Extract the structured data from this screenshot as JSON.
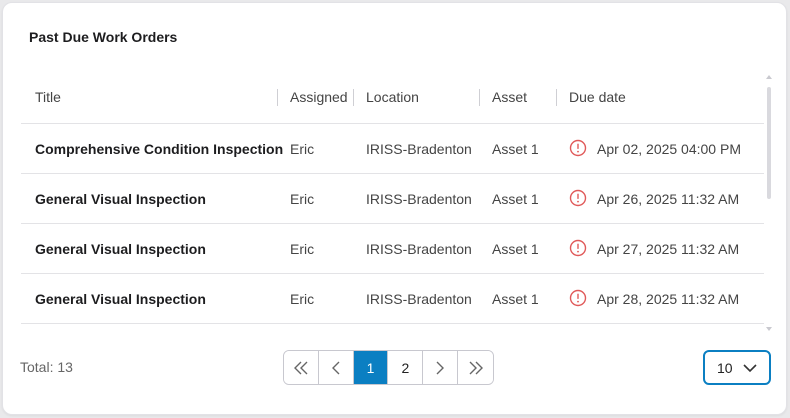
{
  "card": {
    "title": "Past Due Work Orders"
  },
  "table": {
    "columns": [
      "Title",
      "Assigned",
      "Location",
      "Asset",
      "Due date"
    ],
    "rows": [
      {
        "title": "Comprehensive Condition Inspection",
        "assigned": "Eric",
        "location": "IRISS-Bradenton",
        "asset": "Asset 1",
        "due": "Apr 02, 2025 04:00 PM"
      },
      {
        "title": "General Visual Inspection",
        "assigned": "Eric",
        "location": "IRISS-Bradenton",
        "asset": "Asset 1",
        "due": "Apr 26, 2025 11:32 AM"
      },
      {
        "title": "General Visual Inspection",
        "assigned": "Eric",
        "location": "IRISS-Bradenton",
        "asset": "Asset 1",
        "due": "Apr 27, 2025 11:32 AM"
      },
      {
        "title": "General Visual Inspection",
        "assigned": "Eric",
        "location": "IRISS-Bradenton",
        "asset": "Asset 1",
        "due": "Apr 28, 2025 11:32 AM"
      }
    ],
    "due_icon": "alert-circle-icon",
    "due_icon_color": "#e05a5a"
  },
  "footer": {
    "total": "Total: 13",
    "pagination": {
      "first_icon": "double-chevron-left-icon",
      "prev_icon": "chevron-left-icon",
      "pages": [
        "1",
        "2"
      ],
      "current_page": "1",
      "next_icon": "chevron-right-icon",
      "last_icon": "double-chevron-right-icon"
    },
    "page_size": {
      "value": "10",
      "icon": "chevron-down-icon"
    }
  },
  "colors": {
    "accent": "#0b7fc2",
    "alert": "#e05a5a"
  }
}
